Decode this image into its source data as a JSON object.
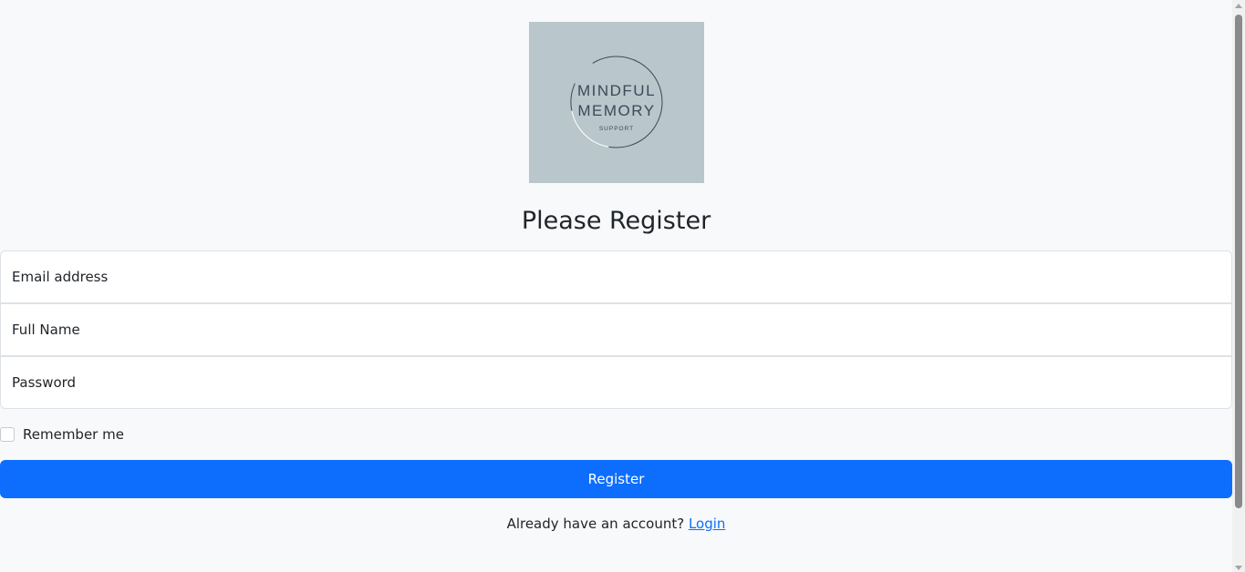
{
  "logo": {
    "line1": "MINDFUL",
    "line2": "MEMORY",
    "line3": "SUPPORT"
  },
  "heading": "Please Register",
  "form": {
    "email_placeholder": "Email address",
    "fullname_placeholder": "Full Name",
    "password_placeholder": "Password",
    "remember_label": "Remember me",
    "remember_checked": false,
    "submit_label": "Register"
  },
  "footer": {
    "prompt": "Already have an account?",
    "login_link": "Login"
  },
  "colors": {
    "background": "#f8f9fa",
    "primary": "#0d6efd",
    "logo_bg": "#b9c6cb"
  }
}
